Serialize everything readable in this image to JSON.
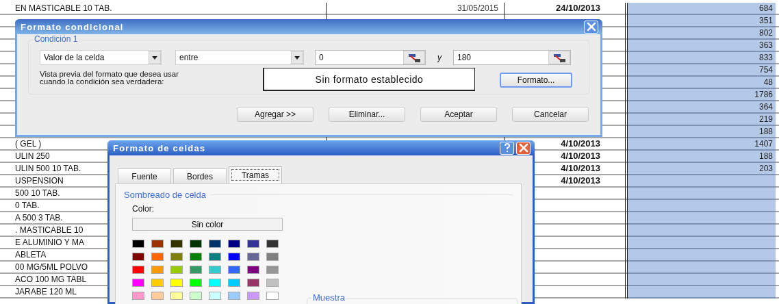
{
  "sheet": {
    "rows": [
      {
        "column_1": "EN MASTICABLE 10 TAB.",
        "column_2": "31/05/2015",
        "column_3": "24/10/2013",
        "column_4": "684"
      },
      {
        "column_4": "351"
      },
      {
        "column_4": "802"
      },
      {
        "column_4": "363"
      },
      {
        "column_4": "833"
      },
      {
        "column_4": "754"
      },
      {
        "column_4": "48"
      },
      {
        "column_4": "1786"
      },
      {
        "column_4": "364"
      },
      {
        "column_4": "219"
      },
      {
        "column_4": "188"
      },
      {
        "column_1": "( GEL )",
        "column_3": "4/10/2013",
        "column_4": "1407"
      },
      {
        "column_1": "ULIN 250",
        "column_3": "4/10/2013",
        "column_4": "188"
      },
      {
        "column_1": "ULIN 500 10 TAB.",
        "column_3": "4/10/2013",
        "column_4": "203"
      },
      {
        "column_1": "USPENSION",
        "column_3": "4/10/2013"
      },
      {
        "column_1": "500 10 TAB."
      },
      {
        "column_1": "0 TAB."
      },
      {
        "column_1": "A 500 3 TAB."
      },
      {
        "column_1": ". MASTICABLE 10"
      },
      {
        "column_1": "E ALUMINIO Y MA"
      },
      {
        "column_1": "ABLETA"
      },
      {
        "column_1": "00 MG/5ML POLVO"
      },
      {
        "column_1": "ACO 100 MG TABL"
      },
      {
        "column_1": "JARABE 120 ML"
      }
    ]
  },
  "conditional_format_dialog": {
    "title": "Formato condicional",
    "condition": {
      "label": "Condición 1",
      "operand": "Valor de la celda",
      "operator": "entre",
      "value_1": "0",
      "joiner": "y",
      "value_2": "180",
      "preview_label": "Vista previa del formato que desea usar cuando la condición sea verdadera:",
      "preview": "Sin formato establecido",
      "format_button": "Formato..."
    },
    "buttons": [
      "Agregar >>",
      "Eliminar...",
      "Aceptar",
      "Cancelar"
    ]
  },
  "format_cells_dialog": {
    "title": "Formato de celdas",
    "tabs": [
      {
        "label": "Fuente",
        "selected": false
      },
      {
        "label": "Bordes",
        "selected": false
      },
      {
        "label": "Tramas",
        "selected": true
      }
    ],
    "section": "Sombreado de celda",
    "color_label": "Color:",
    "no_color_button": "Sin color",
    "swatches": [
      {
        "color": "#000000"
      },
      {
        "color": "#993300"
      },
      {
        "color": "#333300"
      },
      {
        "color": "#003300"
      },
      {
        "color": "#003366"
      },
      {
        "color": "#000080"
      },
      {
        "color": "#333399"
      },
      {
        "color": "#333333"
      },
      {
        "color": "#800000"
      },
      {
        "color": "#ff6600"
      },
      {
        "color": "#808000"
      },
      {
        "color": "#008000"
      },
      {
        "color": "#008080"
      },
      {
        "color": "#0000ff"
      },
      {
        "color": "#666699"
      },
      {
        "color": "#808080"
      },
      {
        "color": "#ff0000"
      },
      {
        "color": "#ff9900"
      },
      {
        "color": "#99cc00"
      },
      {
        "color": "#339966"
      },
      {
        "color": "#33cccc"
      },
      {
        "color": "#3366ff"
      },
      {
        "color": "#800080"
      },
      {
        "color": "#969696"
      },
      {
        "color": "#ff00ff"
      },
      {
        "color": "#ffcc00"
      },
      {
        "color": "#ffff00"
      },
      {
        "color": "#00ff00"
      },
      {
        "color": "#00ffff"
      },
      {
        "color": "#00ccff"
      },
      {
        "color": "#993366"
      },
      {
        "color": "#c0c0c0"
      },
      {
        "color": "#ff99cc"
      },
      {
        "color": "#ffcc99"
      },
      {
        "color": "#ffff99"
      },
      {
        "color": "#ccffcc"
      },
      {
        "color": "#ccffff"
      },
      {
        "color": "#99ccff"
      },
      {
        "color": "#cc99ff"
      },
      {
        "color": "#ffffff"
      }
    ],
    "sample_label": "Muestra"
  }
}
